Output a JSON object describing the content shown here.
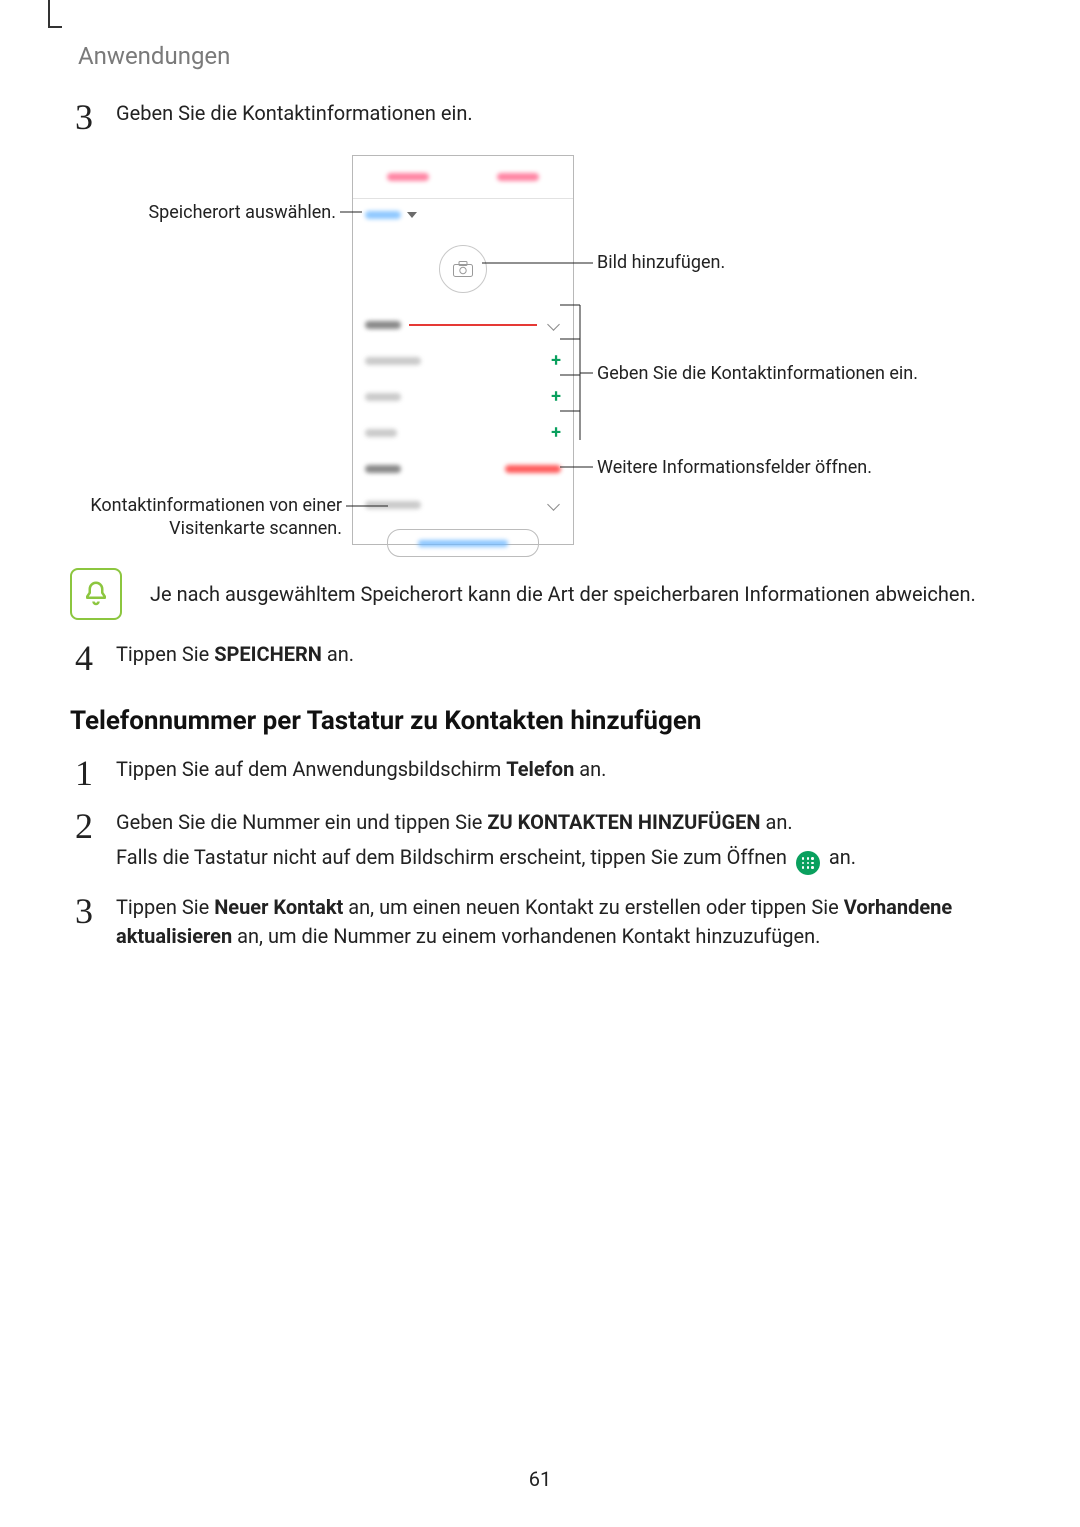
{
  "header": {
    "section": "Anwendungen"
  },
  "step3": {
    "num": "3",
    "text": "Geben Sie die Kontaktinformationen ein."
  },
  "callouts": {
    "storage": "Speicherort auswählen.",
    "addImage": "Bild hinzufügen.",
    "enterInfo": "Geben Sie die Kontaktinformationen ein.",
    "moreFields": "Weitere Informationsfelder öffnen.",
    "scanCard1": "Kontaktinformationen von einer",
    "scanCard2": "Visitenkarte scannen."
  },
  "note": {
    "text": "Je nach ausgewähltem Speicherort kann die Art der speicherbaren Informationen abweichen."
  },
  "step4": {
    "num": "4",
    "pre": "Tippen Sie ",
    "bold": "SPEICHERN",
    "post": " an."
  },
  "section2": {
    "title": "Telefonnummer per Tastatur zu Kontakten hinzufügen"
  },
  "s2step1": {
    "num": "1",
    "pre": "Tippen Sie auf dem Anwendungsbildschirm ",
    "bold": "Telefon",
    "post": " an."
  },
  "s2step2": {
    "num": "2",
    "pre": "Geben Sie die Nummer ein und tippen Sie ",
    "bold": "ZU KONTAKTEN HINZUFÜGEN",
    "post": " an.",
    "line2pre": "Falls die Tastatur nicht auf dem Bildschirm erscheint, tippen Sie zum Öffnen ",
    "line2post": " an."
  },
  "s2step3": {
    "num": "3",
    "pre": "Tippen Sie ",
    "bold1": "Neuer Kontakt",
    "mid": " an, um einen neuen Kontakt zu erstellen oder tippen Sie ",
    "bold2pre": "Vorhandene",
    "bold2post": "aktualisieren",
    "post": " an, um die Nummer zu einem vorhandenen Kontakt hinzuzufügen."
  },
  "pageNumber": "61"
}
